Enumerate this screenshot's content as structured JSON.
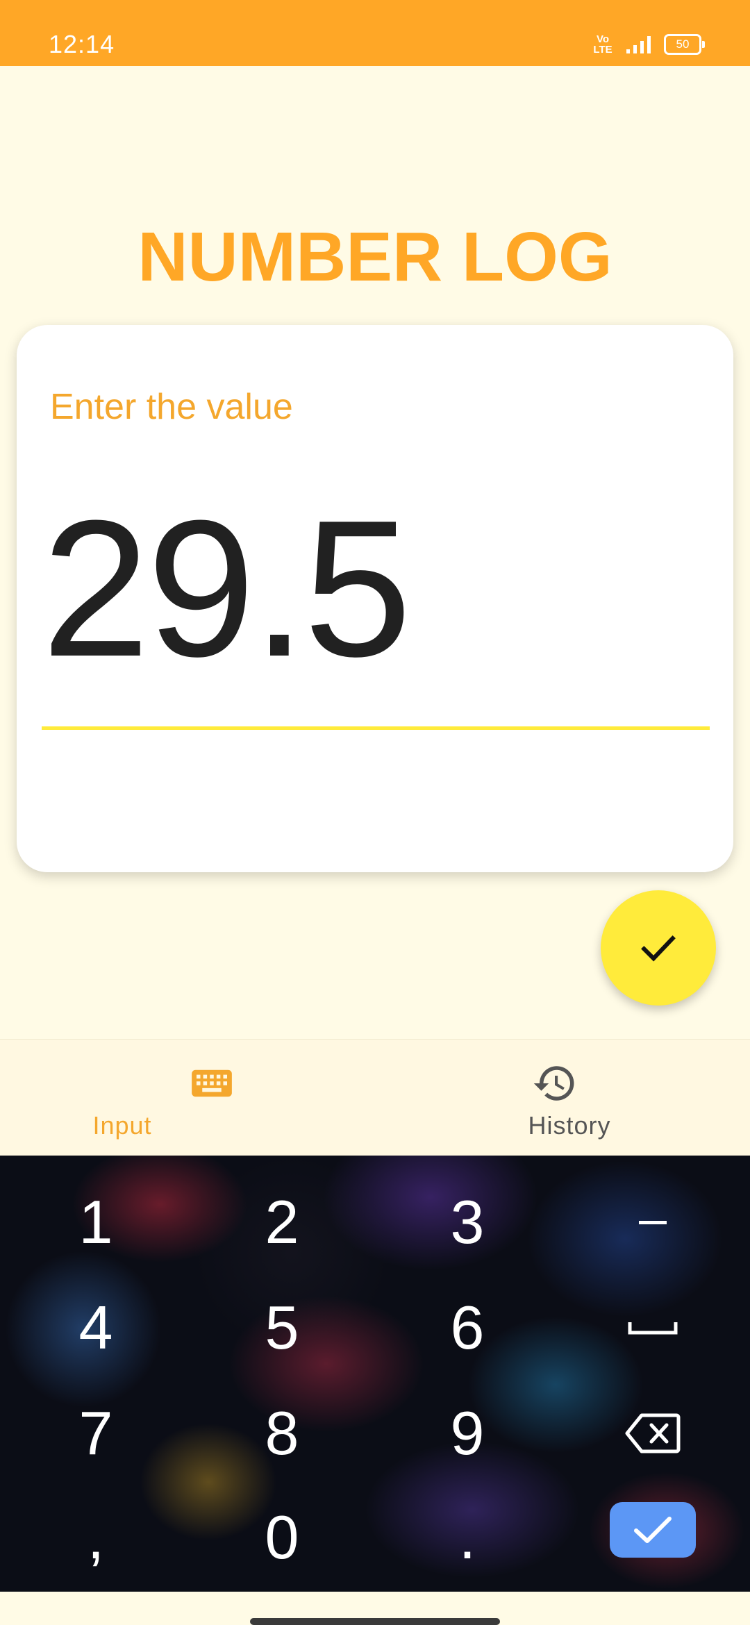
{
  "status_bar": {
    "time": "12:14",
    "volte": "Vo LTE",
    "battery": "50"
  },
  "app": {
    "title": "NUMBER LOG"
  },
  "input_card": {
    "label": "Enter the value",
    "value": "29.5"
  },
  "fab": {
    "icon": "check-icon"
  },
  "bottom_nav": {
    "items": [
      {
        "label": "Input",
        "icon": "keyboard-icon",
        "active": true
      },
      {
        "label": "History",
        "icon": "history-icon",
        "active": false
      }
    ]
  },
  "keyboard": {
    "rows": [
      [
        "1",
        "2",
        "3",
        "−"
      ],
      [
        "4",
        "5",
        "6",
        "space"
      ],
      [
        "7",
        "8",
        "9",
        "backspace"
      ],
      [
        ",",
        "0",
        ".",
        "enter"
      ]
    ]
  },
  "colors": {
    "accent": "#FFA726",
    "accent_text": "#F4A72D",
    "fab": "#FFEB3B",
    "background": "#FFFBE6",
    "enter_key": "#5C97F5"
  }
}
